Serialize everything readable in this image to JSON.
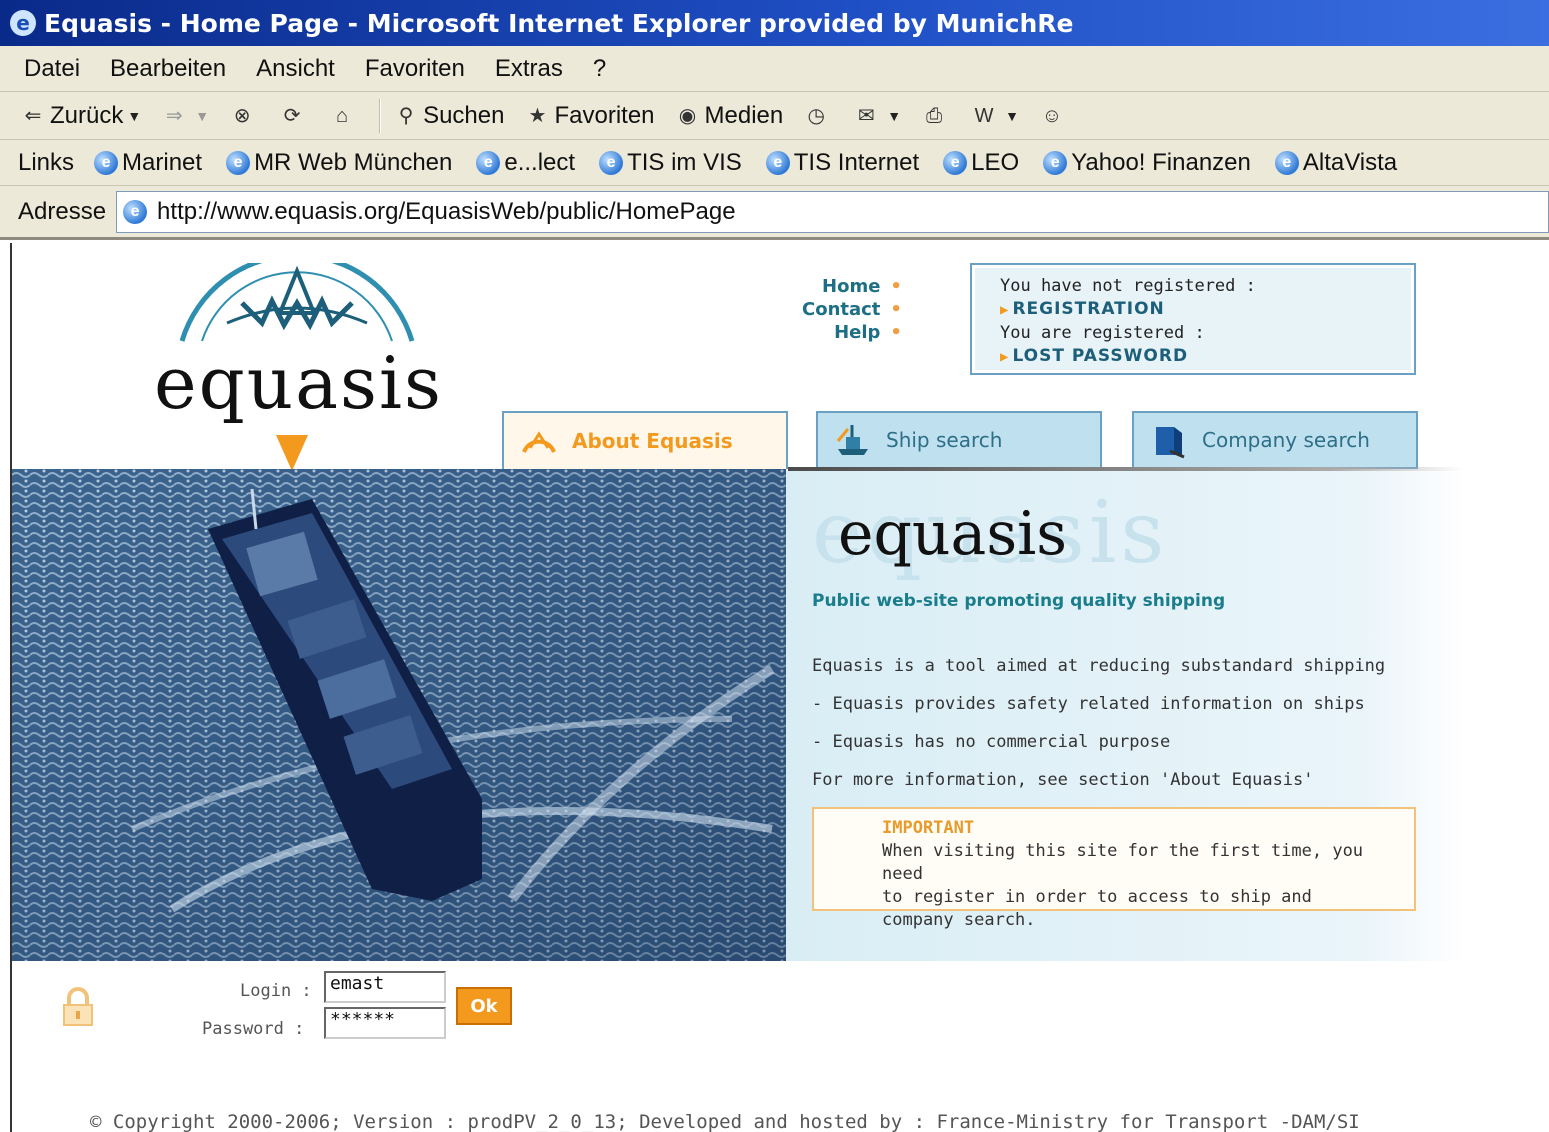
{
  "window": {
    "title": "Equasis - Home Page - Microsoft Internet Explorer provided by MunichRe"
  },
  "menu": [
    "Datei",
    "Bearbeiten",
    "Ansicht",
    "Favoriten",
    "Extras",
    "?"
  ],
  "toolbar": {
    "back": "Zurück",
    "search": "Suchen",
    "favorites": "Favoriten",
    "media": "Medien"
  },
  "links": {
    "label": "Links",
    "items": [
      "Marinet",
      "MR Web München",
      "e...lect",
      "TIS im VIS",
      "TIS Internet",
      "LEO",
      "Yahoo! Finanzen",
      "AltaVista"
    ]
  },
  "address": {
    "label": "Adresse",
    "url": "http://www.equasis.org/EquasisWeb/public/HomePage"
  },
  "site": {
    "logo_text": "equasis",
    "nav": [
      "Home",
      "Contact",
      "Help"
    ],
    "registration": {
      "not_registered": "You have not registered :",
      "registration_link": "REGISTRATION",
      "registered": "You are registered :",
      "lost_password_link": "LOST PASSWORD"
    },
    "tabs": [
      "About Equasis",
      "Ship search",
      "Company search"
    ],
    "info": {
      "heading": "equasis",
      "tagline": "Public web-site promoting quality shipping",
      "lines": [
        "Equasis is a tool aimed at reducing substandard shipping",
        "- Equasis provides safety related information on ships",
        "- Equasis has no commercial purpose",
        "For more information, see section 'About Equasis'"
      ],
      "important_title": "IMPORTANT",
      "important_lines": [
        "When visiting this site for the first time, you need",
        "to register in order to access to ship and",
        "company search."
      ]
    },
    "login": {
      "login_label": "Login :",
      "login_value": "emast",
      "password_label": "Password :",
      "password_value": "******",
      "ok_label": "Ok"
    },
    "footer": "© Copyright 2000-2006; Version : prodPV_2_0_13; Developed and hosted by : France-Ministry for Transport -DAM/SI"
  },
  "colors": {
    "accent_orange": "#f39a1e",
    "teal": "#1d6f86",
    "tab_blue": "#bfe0ef"
  }
}
